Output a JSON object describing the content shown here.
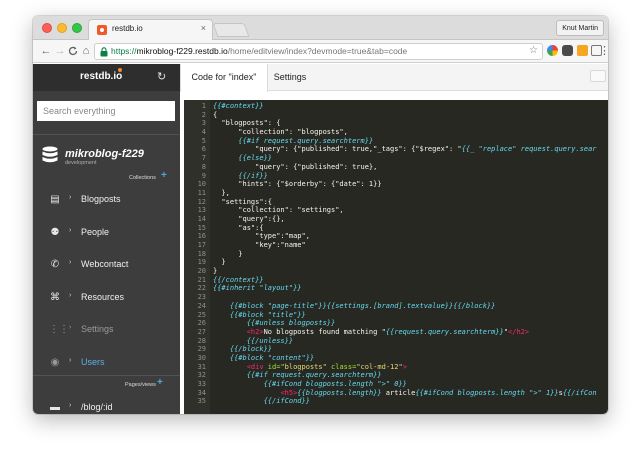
{
  "browser": {
    "tab_title": "restdb.io",
    "tab_close": "×",
    "profile": "Knut Martin",
    "url_secure": "https://",
    "url_host": "mikroblog-f229.restdb.io",
    "url_path": "/home/editview/index?devmode=true&tab=code",
    "nav_back": "←",
    "nav_forward": "→",
    "nav_reload": "C",
    "nav_home": "⌂",
    "star": "☆"
  },
  "sidebar": {
    "logo": "restdb.io",
    "refresh_icon": "↻",
    "search_placeholder": "Search everything",
    "db_name": "mikroblog-f229",
    "db_env": "development",
    "collections_label": "Collections",
    "pages_label": "Pages/views",
    "plus": "+",
    "chevron": "›",
    "items": [
      {
        "label": "Blogposts",
        "icon": "document-icon",
        "glyph": "▤"
      },
      {
        "label": "People",
        "icon": "people-icon",
        "glyph": "⚉"
      },
      {
        "label": "Webcontact",
        "icon": "contact-icon",
        "glyph": "✆"
      },
      {
        "label": "Resources",
        "icon": "resources-icon",
        "glyph": "⌘"
      },
      {
        "label": "Settings",
        "icon": "grid-icon",
        "glyph": "⋮⋮"
      },
      {
        "label": "Users",
        "icon": "user-icon",
        "glyph": "◉"
      },
      {
        "label": "/blog/:id",
        "icon": "page-icon",
        "glyph": "▬"
      }
    ]
  },
  "main": {
    "tabs": [
      {
        "label": "Code for \"index\""
      },
      {
        "label": "Settings"
      }
    ]
  },
  "code": [
    {
      "n": "1",
      "html": "<span class=\"hb\">{{#context}}</span>"
    },
    {
      "n": "2",
      "html": "{"
    },
    {
      "n": "3",
      "html": "  \"blogposts\": {"
    },
    {
      "n": "4",
      "html": "      \"collection\": \"blogposts\","
    },
    {
      "n": "5",
      "html": "      <span class=\"hb\">{{#if request.query.searchterm}}</span>"
    },
    {
      "n": "6",
      "html": "          \"query\": {\"published\": true,\"_tags\": {\"$regex\": \"<span class=\"hb\">{{_ \"replace\" request.query.sear</span>"
    },
    {
      "n": "7",
      "html": "      <span class=\"hb\">{{else}}</span>"
    },
    {
      "n": "8",
      "html": "          \"query\": {\"published\": true},"
    },
    {
      "n": "9",
      "html": "      <span class=\"hb\">{{/if}}</span>"
    },
    {
      "n": "10",
      "html": "      \"hints\": {\"$orderby\": {\"date\": 1}}"
    },
    {
      "n": "11",
      "html": "  },"
    },
    {
      "n": "12",
      "html": "  \"settings\":{"
    },
    {
      "n": "13",
      "html": "      \"collection\": \"settings\","
    },
    {
      "n": "14",
      "html": "      \"query\":{},"
    },
    {
      "n": "15",
      "html": "      \"as\":{"
    },
    {
      "n": "16",
      "html": "          \"type\":\"map\","
    },
    {
      "n": "17",
      "html": "          \"key\":\"name\""
    },
    {
      "n": "18",
      "html": "      }"
    },
    {
      "n": "19",
      "html": "  }"
    },
    {
      "n": "20",
      "html": "}"
    },
    {
      "n": "21",
      "html": "<span class=\"hb\">{{/context}}</span>"
    },
    {
      "n": "22",
      "html": "<span class=\"hb\">{{#inherit \"layout\"}}</span>"
    },
    {
      "n": "23",
      "html": ""
    },
    {
      "n": "24",
      "html": "    <span class=\"hb\">{{#block \"page-title\"}}{{settings.[brand].textvalue}}{{/block}}</span>"
    },
    {
      "n": "25",
      "html": "    <span class=\"hb\">{{#block \"title\"}}</span>"
    },
    {
      "n": "26",
      "html": "        <span class=\"hb\">{{#unless blogposts}}</span>"
    },
    {
      "n": "27",
      "html": "        <span class=\"tg\">&lt;h2&gt;</span>No blogposts found matching \"<span class=\"hb\">{{request.query.searchterm}}</span>\"<span class=\"tg\">&lt;/h2&gt;</span>"
    },
    {
      "n": "28",
      "html": "        <span class=\"hb\">{{/unless}}</span>"
    },
    {
      "n": "29",
      "html": "    <span class=\"hb\">{{/block}}</span>"
    },
    {
      "n": "30",
      "html": "    <span class=\"hb\">{{#block \"content\"}}</span>"
    },
    {
      "n": "31",
      "html": "        <span class=\"tg\">&lt;div</span> <span class=\"at\">id=</span><span class=\"st\">\"blogposts\"</span> <span class=\"at\">class=</span><span class=\"st\">\"col-md-12\"</span><span class=\"tg\">&gt;</span>"
    },
    {
      "n": "32",
      "html": "        <span class=\"hb\">{{#if request.query.searchterm}}</span>"
    },
    {
      "n": "33",
      "html": "            <span class=\"hb\">{{#ifCond blogposts.length \"&gt;\" 0}}</span>"
    },
    {
      "n": "34",
      "html": "                <span class=\"tg\">&lt;h5&gt;</span><span class=\"hb\">{{blogposts.length}}</span> article<span class=\"hb\">{{#ifCond blogposts.length \"&gt;\" 1}}</span>s<span class=\"hb\">{{/ifCon</span>"
    },
    {
      "n": "35",
      "html": "            <span class=\"hb\">{{/ifCond}}</span>"
    }
  ]
}
